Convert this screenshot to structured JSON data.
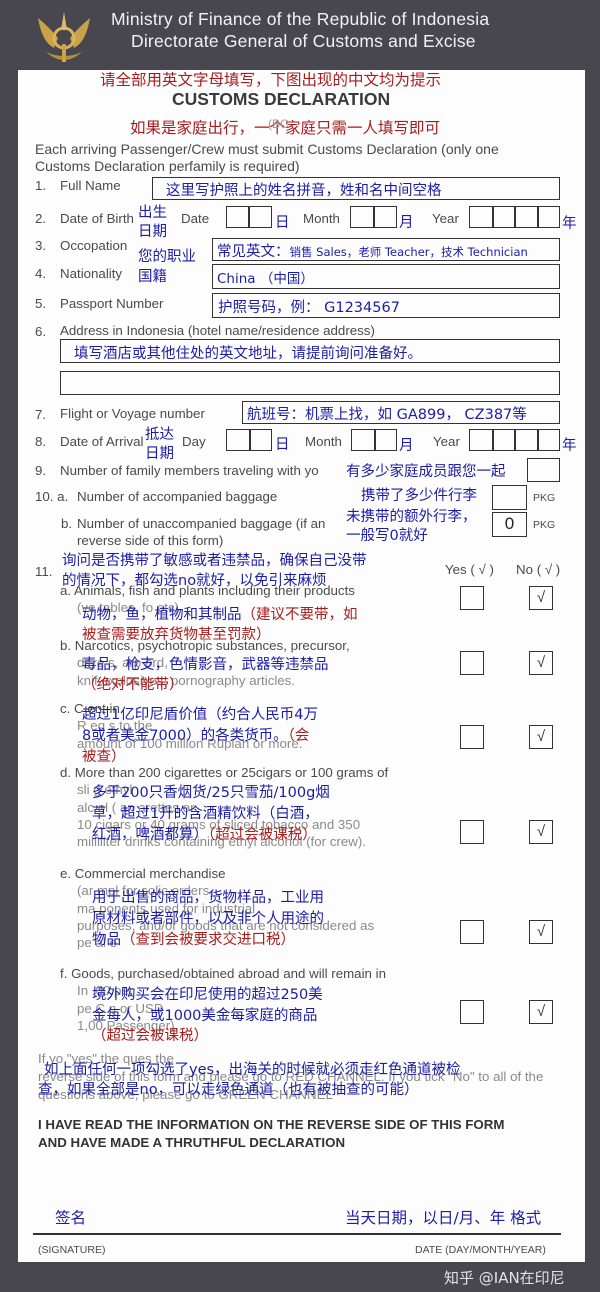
{
  "header": {
    "line1": "Ministry of Finance of the Republic of Indonesia",
    "line2": "Directorate General of Customs and Excise",
    "emblem": "customs-emblem"
  },
  "form": {
    "note_top": "请全部用英文字母填写，下图出现的中文均为提示",
    "title": "CUSTOMS DECLARATION",
    "note_family_a": "如果是家庭出行，",
    "form_code": "(BC",
    "note_family_b": "一个家庭只需一人填写即可",
    "intro_1": "Each arriving Passenger/Crew must submit Customs Declaration (only one",
    "intro_2": "Customs Declaration perfamily is required)",
    "fields": {
      "full_name": {
        "num": "1.",
        "label": "Full Name",
        "value": "这里写护照上的姓名拼音，姓和名中间空格"
      },
      "dob": {
        "num": "2.",
        "label": "Date of Birth",
        "hint": [
          "出生",
          "日期"
        ],
        "date": "Date",
        "month": "Month",
        "year": "Year",
        "day_cn": "日",
        "month_cn": "月",
        "year_cn": "年"
      },
      "occupation": {
        "num": "3.",
        "label": "Occopation",
        "hint": "您的职业",
        "value": "常见英文：",
        "value_small": "销售 Sales，老师 Teacher，技术 Technician"
      },
      "nationality": {
        "num": "4.",
        "label": "Nationality",
        "hint": "国籍",
        "value": "China （中国）"
      },
      "passport": {
        "num": "5.",
        "label": "Passport Number",
        "value": "护照号码，例：  G1234567"
      },
      "address": {
        "num": "6.",
        "label": "Address in Indonesia (hotel name/residence address)",
        "value": "填写酒店或其他住处的英文地址，请提前询问准备好。",
        "value_line2": ""
      },
      "flight": {
        "num": "7.",
        "label": "Flight or Voyage number",
        "value": "航班号：机票上找，如 GA899，  CZ387等"
      },
      "arrival": {
        "num": "8.",
        "label": "Date of Arrival",
        "hint": [
          "抵达",
          "日期"
        ],
        "day": "Day",
        "month": "Month",
        "year": "Year",
        "day_cn": "日",
        "month_cn": "月",
        "year_cn": "年"
      },
      "family": {
        "num": "9.",
        "label": "Number of family members traveling with yo",
        "hint": "有多少家庭成员跟您一起",
        "value": ""
      },
      "acc_baggage": {
        "num": "10. a.",
        "label": "Number of accompanied baggage",
        "hint": "携带了多少件行李",
        "value": "",
        "unit": "PKG"
      },
      "unacc_baggage": {
        "num": "b.",
        "label": "Number of unaccompanied baggage (if an",
        "label_2": "reverse side of this form)",
        "hint": [
          "未携带的额外行李，",
          "一般写0就好"
        ],
        "value": "0",
        "unit": "PKG"
      }
    },
    "q11": {
      "num": "11.",
      "hint": [
        "询问是否携带了敏感或者违禁品，确保自己没带",
        "的情况下，都勾选no就好，以免引来麻烦"
      ],
      "yes_label": "Yes ( √ )",
      "no_label": "No ( √ )",
      "items": [
        {
          "en": [
            "a. Animals, fish and plants including their products",
            "(ve  tables, fo    etc)"
          ],
          "cn": [
            "动物，鱼，植物和其制品"
          ],
          "red": [
            "（建议不要带，如",
            "被查需要放弃货物甚至罚款）"
          ],
          "yes": false,
          "no": true
        },
        {
          "en": [
            "b. Narcotics,  psychotropic  substances,  precursor,",
            "dr            re    s,              arp                 ord,",
            "knif                        explosives, pornography articles."
          ],
          "cn": [
            "毒品，枪支，色情影音，武器等违禁品"
          ],
          "red": [
            "（绝对不能带）"
          ],
          "yes": false,
          "no": true
        },
        {
          "en": [
            "c. C                                          ent      in",
            "R                                             eq     s   to   the",
            "amount of 100 million Rupiah or more."
          ],
          "cn": [
            "超过1亿印尼盾价值（约合人民币4万",
            "8或者美金7000）的各类货币。"
          ],
          "red": [
            "（会",
            "被查）"
          ],
          "yes": false,
          "no": true
        },
        {
          "en": [
            "d. More than 200 cigarettes or 25cigars or 100 grams of",
            "sli                                                g   ethyl",
            "alc  ol (                          an              arettes or",
            "10   cigars or 40 grams of sliced tobacco  and  350",
            "milliliter drinks containing ethyl alcohol (for crew)."
          ],
          "cn": [
            "多于200只香烟货/25只雪茄/100g烟",
            "草，超过1升的含酒精饮料（白酒，",
            "红酒，啤酒都算）"
          ],
          "red": [
            "（超过会被课税）"
          ],
          "yes": false,
          "no": true
        },
        {
          "en": [
            "e. Commercial merchandise",
            "(ar                      mpl        for   solic       orders,",
            "ma                      ponents   used   for   industrial",
            "purposes, and/or goods that are not considered as",
            "pe      al e"
          ],
          "cn": [
            "用于出售的商品，货物样品，工业用",
            "原材料或者部件，以及非个人用途的",
            "物品"
          ],
          "red": [
            "（查到会被要求交进口税）"
          ],
          "yes": false,
          "no": true
        },
        {
          "en": [
            "f. Goods, purchased/obtained abroad and will remain in",
            "In                                                  .00  per",
            "pe              C                                 n or USD",
            "1,00                          Passenger)."
          ],
          "cn": [
            "境外购买会在印尼使用的超过250美",
            "金每人，或1000美金每家庭的商品"
          ],
          "red": [
            "（超过会被课税）"
          ],
          "yes": false,
          "no": true
        }
      ]
    },
    "channel_en": [
      "If yo                \"yes\"                the ques                                                                  the",
      "reverse side of this form and please go to RED CHANNEL. If you tick \"No\" to all of the",
      "questions above, please go to GREEN CHANNEL"
    ],
    "channel_cn": [
      "如上面任何一项勾选了yes，出海关的时候就必须走红色通道被检",
      "查，如果全部是no，可以走绿色通道（也有被抽查的可能）"
    ],
    "declaration": [
      "I HAVE READ THE INFORMATION ON THE REVERSE SIDE OF THIS FORM",
      "AND HAVE MADE A THRUTHFUL DECLARATION"
    ],
    "signature_hint": "签名",
    "date_hint": "当天日期，以日/月、年 格式",
    "signature_label": "(SIGNATURE)",
    "date_label": "DATE (DAY/MONTH/YEAR)"
  },
  "watermark": "知乎 @IAN在印尼",
  "colors": {
    "background": "#48464f",
    "hint_blue": "#1c1ca6",
    "hint_red": "#a81c1c",
    "paper": "#fdfdfd"
  }
}
